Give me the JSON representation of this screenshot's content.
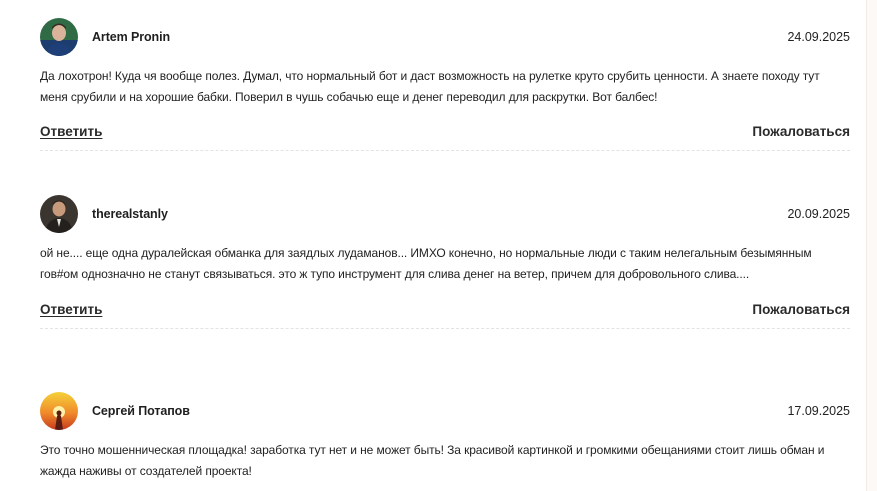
{
  "comments": [
    {
      "author": "Artem Pronin",
      "date": "24.09.2025",
      "avatar_icon": "avatar-man-photo",
      "text": "Да лохотрон! Куда чя вообще полез. Думал, что нормальный бот и даст возможность на рулетке круто срубить ценности. А знаете походу тут меня срубили и на хорошие бабки. Поверил в чушь собачью еще и денег переводил для раскрутки. Вот балбес!",
      "reply_label": "Ответить",
      "report_label": "Пожаловаться"
    },
    {
      "author": "therealstanly",
      "date": "20.09.2025",
      "avatar_icon": "avatar-man-suit-photo",
      "text": "ой не.... еще одна дуралейская обманка для заядлых лудаманов... ИМХО конечно, но нормальные люди с таким нелегальным безымянным гов#ом однозначно не станут связываться. это ж тупо инструмент для слива денег на ветер, причем для добровольного слива....",
      "reply_label": "Ответить",
      "report_label": "Пожаловаться"
    },
    {
      "author": "Сергей Потапов",
      "date": "17.09.2025",
      "avatar_icon": "avatar-sunset-photo",
      "text": "Это точно мошенническая площадка! заработка тут нет и не может быть! За красивой картинкой и громкими обещаниями стоит лишь обман и жажда наживы от создателей проекта!"
    }
  ]
}
